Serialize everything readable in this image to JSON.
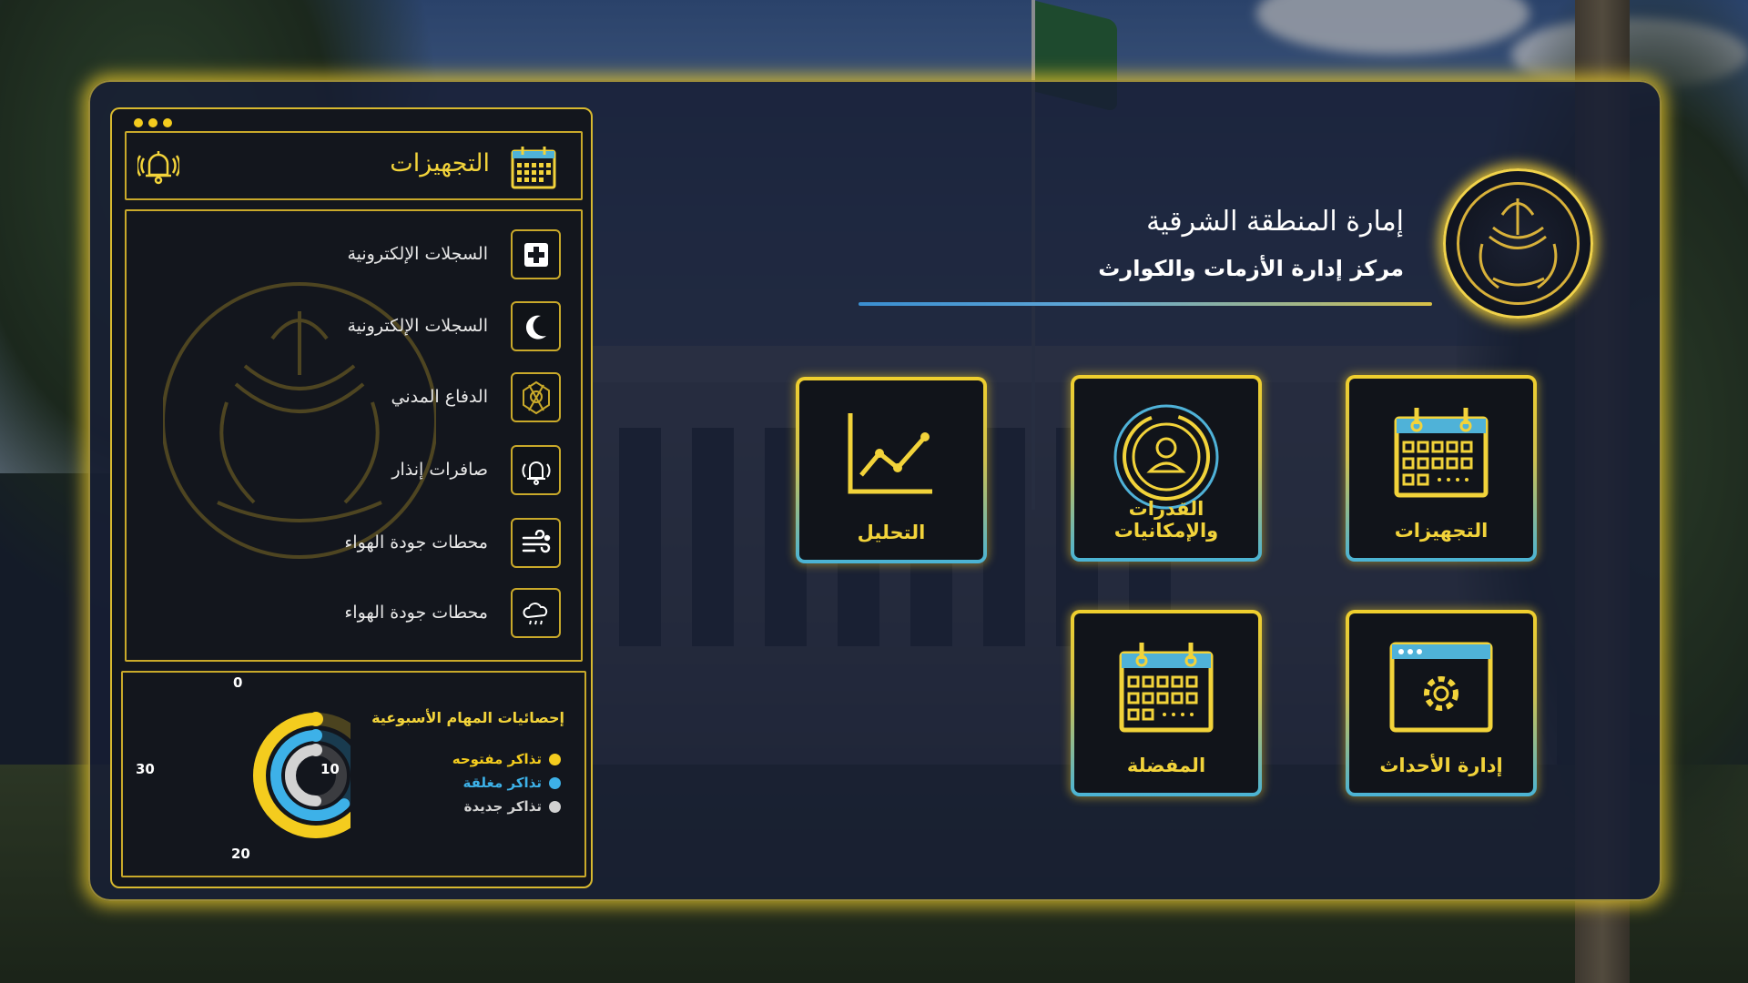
{
  "panel": {
    "title": "التجهيزات",
    "items": [
      {
        "label": "السجلات الإلكترونية",
        "icon": "medical-cross-icon"
      },
      {
        "label": "السجلات الإلكترونية",
        "icon": "crescent-moon-icon"
      },
      {
        "label": "الدفاع المدني",
        "icon": "civil-defense-icon"
      },
      {
        "label": "صافرات إنذار",
        "icon": "siren-bell-icon"
      },
      {
        "label": "محطات جودة الهواء",
        "icon": "wind-icon"
      },
      {
        "label": "محطات جودة الهواء",
        "icon": "weather-cloud-icon"
      }
    ]
  },
  "stats": {
    "title": "إحصائيات المهام الأسبوعية",
    "legend": [
      {
        "label": "تذاكر مفتوحه",
        "color": "#f4cc1e"
      },
      {
        "label": "تذاكر مغلقة",
        "color": "#3db1e8"
      },
      {
        "label": "تذاكر جديدة",
        "color": "#d2d2d2"
      }
    ],
    "ticks": {
      "top": "0",
      "right": "10",
      "bottom": "20",
      "left": "30"
    }
  },
  "chart_data": {
    "type": "radial-bar",
    "categories": [
      "تذاكر مفتوحه",
      "تذاكر مغلقة",
      "تذاكر جديدة"
    ],
    "values": [
      30,
      25,
      20
    ],
    "scale_max": 40,
    "colors": [
      "#f4cc1e",
      "#3db1e8",
      "#d2d2d2"
    ]
  },
  "header": {
    "org_name": "إمارة المنطقة الشرقية",
    "center_name": "مركز  إدارة الأزمات والكوارث"
  },
  "tiles": [
    {
      "label": "التجهيزات",
      "icon": "calendar-icon"
    },
    {
      "label": "القدرات والإمكانيات",
      "icon": "user-circle-icon"
    },
    {
      "label": "التحليل",
      "icon": "line-chart-icon"
    },
    {
      "label": "إدارة الأحداث",
      "icon": "browser-gear-icon"
    },
    {
      "label": "المفضلة",
      "icon": "calendar-icon"
    }
  ]
}
